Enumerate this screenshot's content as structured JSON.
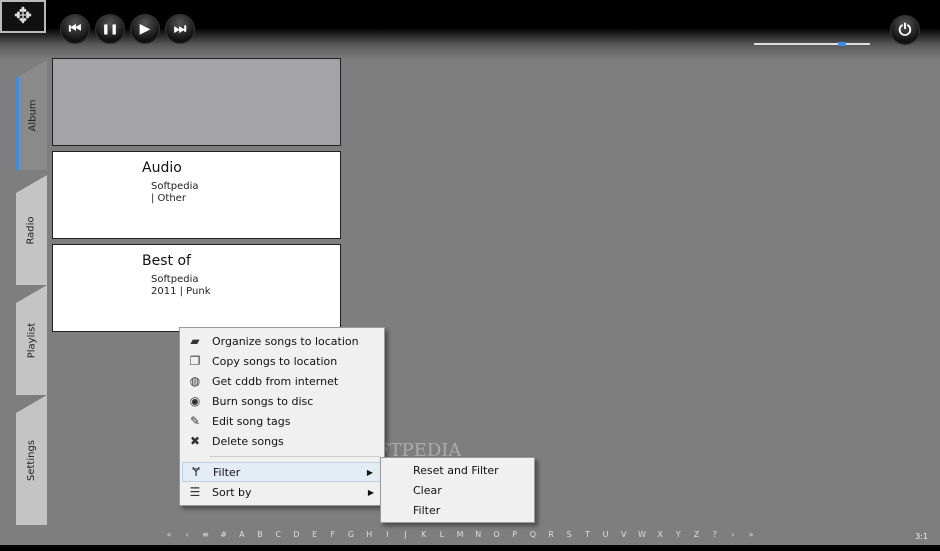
{
  "toolbar": {
    "move_icon": "move-arrows-icon",
    "buttons": [
      {
        "name": "previous-button",
        "glyph": "⏮"
      },
      {
        "name": "pause-button",
        "glyph": "❚❚"
      },
      {
        "name": "play-button",
        "glyph": "▶"
      },
      {
        "name": "next-button",
        "glyph": "⏭"
      }
    ],
    "volume": 0.78,
    "power_glyph": "⏻"
  },
  "tabs": [
    "Album",
    "Radio",
    "Playlist",
    "Settings"
  ],
  "albums": [
    {
      "title": "",
      "line1": "",
      "line2": ""
    },
    {
      "title": "Audio",
      "line1": "Softpedia",
      "line2": "| Other"
    },
    {
      "title": "Best of",
      "line1": "Softpedia",
      "line2": "2011 | Punk"
    }
  ],
  "context_menu": {
    "items": [
      {
        "label": "Organize songs to location",
        "icon": "folder-icon",
        "glyph": "▰"
      },
      {
        "label": "Copy songs to location",
        "icon": "copy-icon",
        "glyph": "❐"
      },
      {
        "label": "Get cddb from internet",
        "icon": "globe-icon",
        "glyph": "◍"
      },
      {
        "label": "Burn songs to disc",
        "icon": "disc-icon",
        "glyph": "◉"
      },
      {
        "label": "Edit song tags",
        "icon": "edit-icon",
        "glyph": "✎"
      },
      {
        "label": "Delete songs",
        "icon": "delete-icon",
        "glyph": "✖"
      }
    ],
    "filter": "Filter",
    "sort_by": "Sort by"
  },
  "submenu": [
    "Reset and Filter",
    "Clear",
    "Filter"
  ],
  "alphabet": [
    "«",
    "‹",
    "≡",
    "#",
    "A",
    "B",
    "C",
    "D",
    "E",
    "F",
    "G",
    "H",
    "I",
    "J",
    "K",
    "L",
    "M",
    "N",
    "O",
    "P",
    "Q",
    "R",
    "S",
    "T",
    "U",
    "V",
    "W",
    "X",
    "Y",
    "Z",
    "?",
    "›",
    "»"
  ],
  "page": "3:1",
  "watermark": "SOFTPEDIA"
}
